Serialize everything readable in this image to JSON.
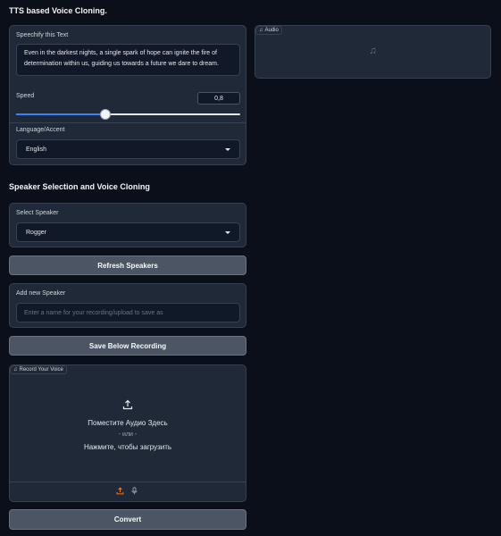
{
  "page_title": "TTS based Voice Cloning.",
  "speechify": {
    "label": "Speechify this Text",
    "text": "Even in the darkest nights, a single spark of hope can ignite the fire of determination within us, guiding us towards a future we dare to dream."
  },
  "speed": {
    "label": "Speed",
    "value": "0,8",
    "fraction": 0.4
  },
  "language": {
    "label": "Language/Accent",
    "selected": "English"
  },
  "audio": {
    "label": "Audio",
    "icon": "music-note-icon"
  },
  "speaker_section_title": "Speaker Selection and Voice Cloning",
  "select_speaker": {
    "label": "Select Speaker",
    "selected": "Rogger"
  },
  "refresh_button": "Refresh Speakers",
  "add_speaker": {
    "label": "Add new Speaker",
    "placeholder": "Enter a name for your recording/upload to save as"
  },
  "save_button": "Save Below Recording",
  "record": {
    "label": "Record Your Voice",
    "drop_text": "Поместите Аудио Здесь",
    "or_text": "- или -",
    "click_text": "Нажмите, чтобы загрузить"
  },
  "convert_button": "Convert",
  "colors": {
    "background": "#0b0f19",
    "panel": "#1f2937",
    "slider_fill": "#3b82f6",
    "upload_icon_accent": "#f97316"
  }
}
